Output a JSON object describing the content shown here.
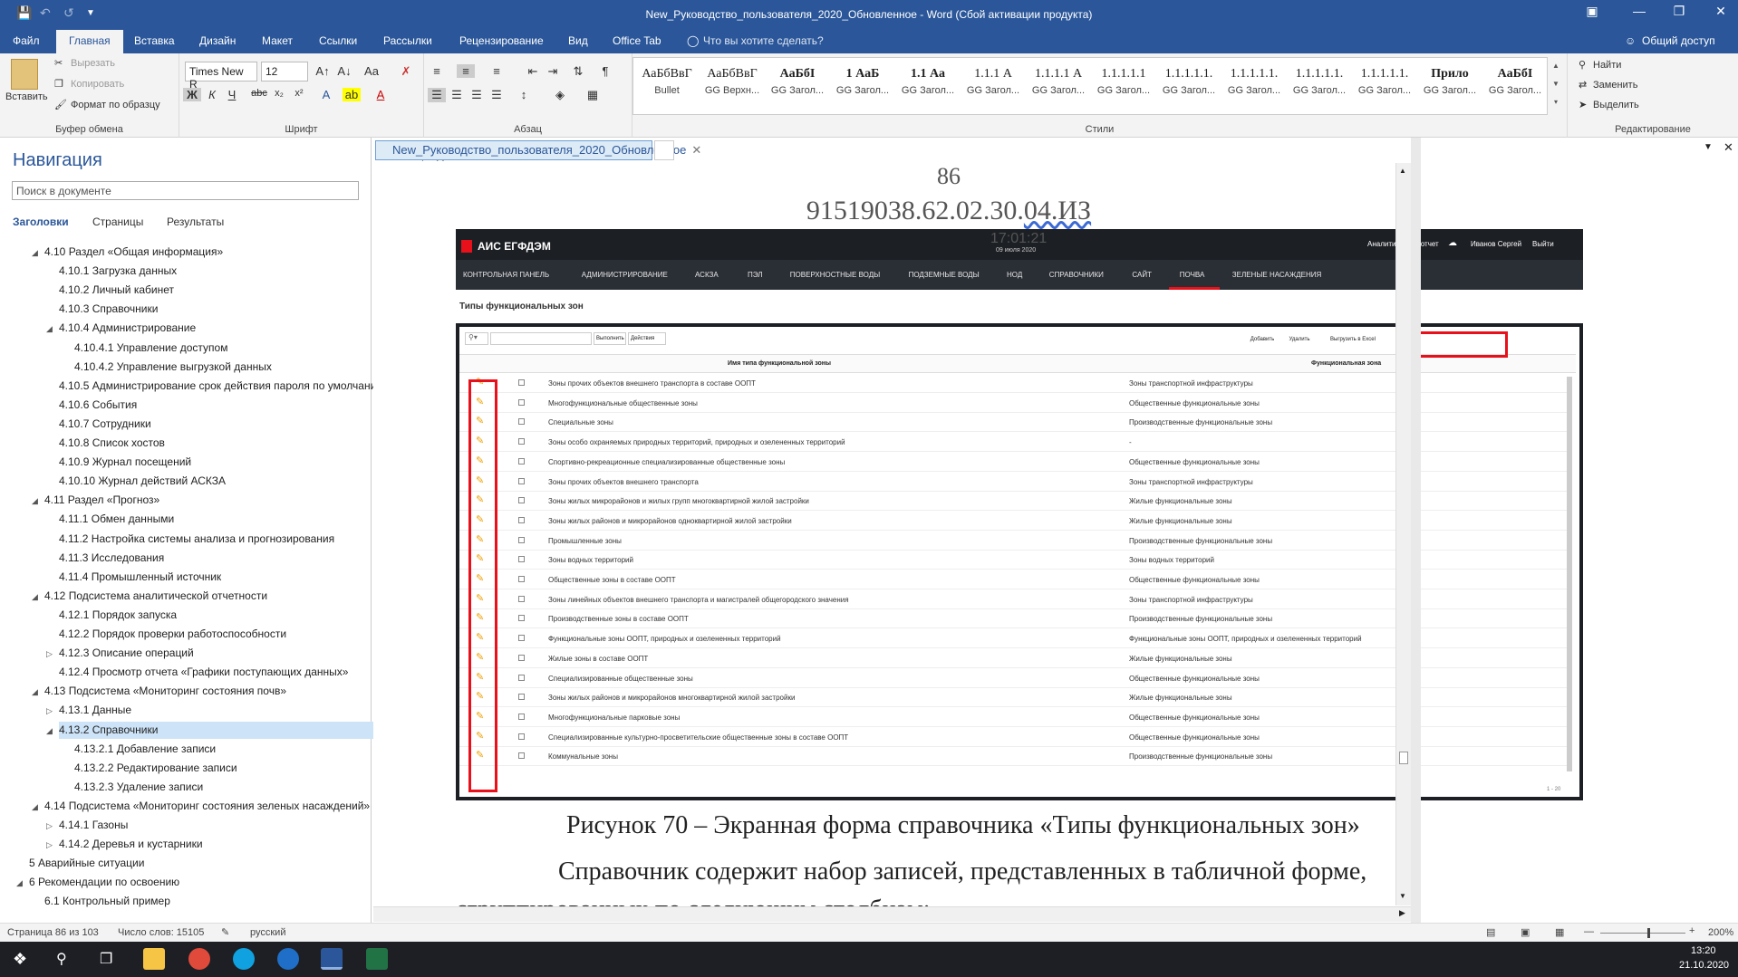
{
  "window": {
    "title": "New_Руководство_пользователя_2020_Обновленное - Word (Сбой активации продукта)"
  },
  "ribbon_tabs": [
    "Файл",
    "Главная",
    "Вставка",
    "Дизайн",
    "Макет",
    "Ссылки",
    "Рассылки",
    "Рецензирование",
    "Вид",
    "Office Tab"
  ],
  "tell_me": "Что вы хотите сделать?",
  "share": "Общий доступ",
  "clipboard": {
    "paste": "Вставить",
    "cut": "Вырезать",
    "copy": "Копировать",
    "format_painter": "Формат по образцу",
    "label": "Буфер обмена"
  },
  "font": {
    "name": "Times New R",
    "size": "12",
    "label": "Шрифт",
    "case": "Aa"
  },
  "paragraph": {
    "label": "Абзац"
  },
  "styles": {
    "label": "Стили",
    "items": [
      {
        "preview": "АаБбВвГ",
        "name": "Bullet"
      },
      {
        "preview": "АаБбВвГ",
        "name": "GG Верхн..."
      },
      {
        "preview": "АаБбI",
        "name": "GG Загол..."
      },
      {
        "preview": "1 АаБ",
        "name": "GG Загол..."
      },
      {
        "preview": "1.1 Аа",
        "name": "GG Загол..."
      },
      {
        "preview": "1.1.1 А",
        "name": "GG Загол..."
      },
      {
        "preview": "1.1.1.1 А",
        "name": "GG Загол..."
      },
      {
        "preview": "1.1.1.1.1",
        "name": "GG Загол..."
      },
      {
        "preview": "1.1.1.1.1.",
        "name": "GG Загол..."
      },
      {
        "preview": "1.1.1.1.1.",
        "name": "GG Загол..."
      },
      {
        "preview": "1.1.1.1.1.",
        "name": "GG Загол..."
      },
      {
        "preview": "1.1.1.1.1.",
        "name": "GG Загол..."
      },
      {
        "preview": "Прило",
        "name": "GG Загол..."
      },
      {
        "preview": "АаБбI",
        "name": "GG Загол..."
      }
    ]
  },
  "editing": {
    "find": "Найти",
    "replace": "Заменить",
    "select": "Выделить",
    "label": "Редактирование"
  },
  "navigation": {
    "title": "Навигация",
    "search_placeholder": "Поиск в документе",
    "tabs": [
      "Заголовки",
      "Страницы",
      "Результаты"
    ],
    "items": [
      {
        "text": "4.10 Раздел «Общая информация»",
        "lvl": 1,
        "tri": "open"
      },
      {
        "text": "4.10.1 Загрузка данных",
        "lvl": 2
      },
      {
        "text": "4.10.2 Личный кабинет",
        "lvl": 2
      },
      {
        "text": "4.10.3 Справочники",
        "lvl": 2
      },
      {
        "text": "4.10.4 Администрирование",
        "lvl": 2,
        "tri": "open"
      },
      {
        "text": "4.10.4.1  Управление доступом",
        "lvl": 3
      },
      {
        "text": "4.10.4.2  Управление выгрузкой данных",
        "lvl": 3
      },
      {
        "text": "4.10.5 Администрирование срок действия пароля по умолчанию",
        "lvl": 2
      },
      {
        "text": "4.10.6 События",
        "lvl": 2
      },
      {
        "text": "4.10.7 Сотрудники",
        "lvl": 2
      },
      {
        "text": "4.10.8 Список хостов",
        "lvl": 2
      },
      {
        "text": "4.10.9 Журнал посещений",
        "lvl": 2
      },
      {
        "text": "4.10.10 Журнал действий АСКЗА",
        "lvl": 2
      },
      {
        "text": "4.11 Раздел «Прогноз»",
        "lvl": 1,
        "tri": "open"
      },
      {
        "text": "4.11.1 Обмен данными",
        "lvl": 2
      },
      {
        "text": "4.11.2 Настройка системы анализа и прогнозирования",
        "lvl": 2
      },
      {
        "text": "4.11.3 Исследования",
        "lvl": 2
      },
      {
        "text": "4.11.4 Промышленный источник",
        "lvl": 2
      },
      {
        "text": "4.12 Подсистема аналитической отчетности",
        "lvl": 1,
        "tri": "open"
      },
      {
        "text": "4.12.1   Порядок запуска",
        "lvl": 2
      },
      {
        "text": "4.12.2   Порядок проверки работоспособности",
        "lvl": 2
      },
      {
        "text": "4.12.3 Описание операций",
        "lvl": 2,
        "tri": "closed"
      },
      {
        "text": "4.12.4 Просмотр отчета «Графики поступающих данных»",
        "lvl": 2
      },
      {
        "text": "4.13 Подсистема «Мониторинг состояния почв»",
        "lvl": 1,
        "tri": "open"
      },
      {
        "text": "4.13.1 Данные",
        "lvl": 2,
        "tri": "closed"
      },
      {
        "text": "4.13.2 Справочники",
        "lvl": 2,
        "tri": "open",
        "sel": true
      },
      {
        "text": "4.13.2.1  Добавление записи",
        "lvl": 3
      },
      {
        "text": "4.13.2.2  Редактирование записи",
        "lvl": 3
      },
      {
        "text": "4.13.2.3  Удаление записи",
        "lvl": 3
      },
      {
        "text": "4.14 Подсистема «Мониторинг состояния зеленых насаждений»",
        "lvl": 1,
        "tri": "open"
      },
      {
        "text": "4.14.1 Газоны",
        "lvl": 2,
        "tri": "closed"
      },
      {
        "text": "4.14.2 Деревья и кустарники",
        "lvl": 2,
        "tri": "closed"
      },
      {
        "text": "5 Аварийные ситуации",
        "lvl": 0
      },
      {
        "text": "6 Рекомендации по освоению",
        "lvl": 0,
        "tri": "open"
      },
      {
        "text": "6.1 Контрольный пример",
        "lvl": 1
      }
    ]
  },
  "doc": {
    "tab": "New_Руководство_пользователя_2020_Обновленное",
    "page_number": "86",
    "doc_code_prefix": "91519038.62.02.30.",
    "doc_code_suffix": "04.ИЗ",
    "caption": "Рисунок 70 – Экранная форма справочника «Типы функциональных зон»",
    "para_line1": "Справочник   содержит   набор   записей,   представленных   в   табличной   форме,",
    "para_line2": "сгруппированных по следующим столбцам:"
  },
  "app": {
    "name": "АИС ЕГФДЭМ",
    "clock": "17:01:21",
    "date": "09 июля 2020",
    "analytic": "Аналитический отчет",
    "user": "Иванов Сергей",
    "exit": "Выйти",
    "menu": [
      "КОНТРОЛЬНАЯ ПАНЕЛЬ",
      "АДМИНИСТРИРОВАНИЕ",
      "АСКЗА",
      "ПЭЛ",
      "ПОВЕРХНОСТНЫЕ ВОДЫ",
      "ПОДЗЕМНЫЕ ВОДЫ",
      "НОД",
      "СПРАВОЧНИКИ",
      "САЙТ",
      "ПОЧВА",
      "ЗЕЛЕНЫЕ НАСАЖДЕНИЯ"
    ],
    "page_title": "Типы функциональных зон",
    "execute": "Выполнить",
    "actions": "Действия",
    "add": "Добавить",
    "delete": "Удалить",
    "export": "Выгрузить в Excel",
    "col1": "Имя типа функциональной зоны",
    "col2": "Функциональная зона",
    "pager": "1 - 20",
    "rows": [
      [
        "Зоны прочих объектов внешнего транспорта в составе ООПТ",
        "Зоны транспортной инфраструктуры"
      ],
      [
        "Многофункциональные общественные зоны",
        "Общественные функциональные зоны"
      ],
      [
        "Специальные зоны",
        "Производственные функциональные зоны"
      ],
      [
        "Зоны особо охраняемых природных территорий, природных и озелененных территорий",
        "-"
      ],
      [
        "Спортивно-рекреационные специализированные общественные зоны",
        "Общественные функциональные зоны"
      ],
      [
        "Зоны прочих объектов внешнего транспорта",
        "Зоны транспортной инфраструктуры"
      ],
      [
        "Зоны жилых микрорайонов и жилых групп многоквартирной жилой застройки",
        "Жилые функциональные зоны"
      ],
      [
        "Зоны жилых районов и микрорайонов одноквартирной жилой застройки",
        "Жилые функциональные зоны"
      ],
      [
        "Промышленные зоны",
        "Производственные функциональные зоны"
      ],
      [
        "Зоны водных территорий",
        "Зоны водных территорий"
      ],
      [
        "Общественные зоны в составе ООПТ",
        "Общественные функциональные зоны"
      ],
      [
        "Зоны линейных объектов внешнего транспорта и магистралей общегородского значения",
        "Зоны транспортной инфраструктуры"
      ],
      [
        "Производственные зоны в составе ООПТ",
        "Производственные функциональные зоны"
      ],
      [
        "Функциональные зоны ООПТ, природных и озелененных территорий",
        "Функциональные зоны ООПТ, природных и озелененных территорий"
      ],
      [
        "Жилые зоны в составе ООПТ",
        "Жилые функциональные зоны"
      ],
      [
        "Специализированные общественные зоны",
        "Общественные функциональные зоны"
      ],
      [
        "Зоны жилых районов и микрорайонов многоквартирной жилой застройки",
        "Жилые функциональные зоны"
      ],
      [
        "Многофункциональные парковые зоны",
        "Общественные функциональные зоны"
      ],
      [
        "Специализированные культурно-просветительские общественные зоны в составе ООПТ",
        "Общественные функциональные зоны"
      ],
      [
        "Коммунальные зоны",
        "Производственные функциональные зоны"
      ]
    ]
  },
  "status": {
    "page": "Страница 86 из 103",
    "words": "Число слов: 15105",
    "lang": "русский",
    "zoom": "200%"
  },
  "taskbar": {
    "time": "13:20",
    "date": "21.10.2020"
  },
  "colors": {
    "word_blue": "#2b579a",
    "app_dark": "#1c1f24",
    "highlight_red": "#e8101a",
    "pencil": "#f0a000"
  }
}
